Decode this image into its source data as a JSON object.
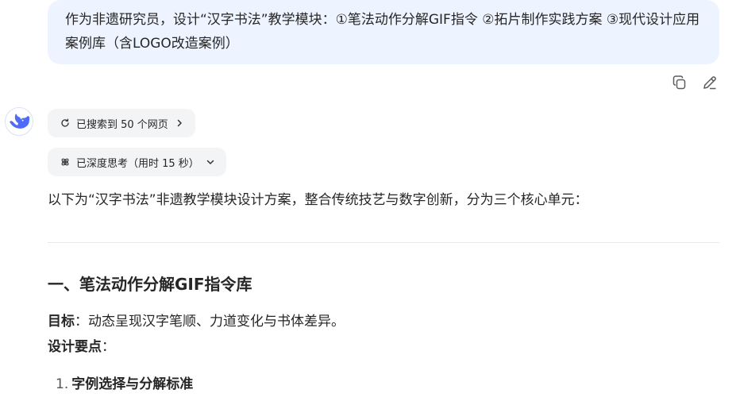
{
  "user_message": {
    "text": "作为非遗研究员，设计“汉字书法”教学模块：①笔法动作分解GIF指令 ②拓片制作实践方案 ③现代设计应用案例库（含LOGO改造案例）"
  },
  "message_actions": {
    "copy_icon": "copy-icon",
    "edit_icon": "edit-icon"
  },
  "assistant": {
    "avatar_icon": "whale-logo-icon",
    "search_pill_label": "已搜索到 50 个网页",
    "think_pill_label": "已深度思考（用时 15 秒）",
    "intro": "以下为“汉字书法”非遗教学模块设计方案，整合传统技艺与数字创新，分为三个核心单元：",
    "section1_heading": "一、笔法动作分解GIF指令库",
    "goal_label": "目标",
    "goal_text": "：动态呈现汉字笔顺、力道变化与书体差异。",
    "design_label": "设计要点",
    "design_colon": "：",
    "list": [
      {
        "num": "1.",
        "text": "字例选择与分解标准"
      }
    ]
  },
  "colors": {
    "user_bubble_bg": "#eef4ff",
    "pill_bg": "#f3f4f6",
    "brand_blue": "#4d6bfe"
  }
}
